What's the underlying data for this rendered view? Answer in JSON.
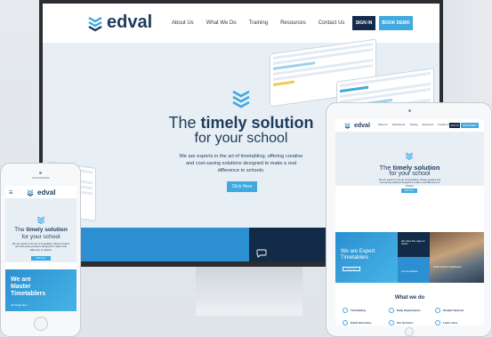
{
  "brand": {
    "name": "edval",
    "color": "#1f3a5b",
    "accent": "#3fa9e0"
  },
  "nav": {
    "links": [
      "About Us",
      "What We Do",
      "Training",
      "Resources",
      "Contact Us"
    ],
    "sign_in": "SIGN IN",
    "book_demo": "BOOK DEMO"
  },
  "hero": {
    "title_prefix": "The ",
    "title_bold": "timely solution",
    "title_line2": "for your school",
    "description": "We are experts in the art of timetabling, offering creative and cost-saving solutions designed to make a real difference to schools.",
    "cta": "Click Here"
  },
  "tablet": {
    "blue_panel": "We are Expert Timetablers",
    "learn_more": "Learn more",
    "dark_panel": "We have 30+ days of hands",
    "mid_panel": "Live timetables",
    "photo_panel": "100% student satisfaction",
    "what_we_do": "What we do",
    "services": [
      "Timetabling",
      "Daily Organisation",
      "Student Options",
      "Edval Interviews",
      "Our Services",
      "Learn more"
    ]
  },
  "phone": {
    "menu_icon": "hamburger-icon",
    "blue_panel_lines": [
      "We are",
      "Master",
      "Timetablers"
    ],
    "blue_sub": "We design like it"
  }
}
